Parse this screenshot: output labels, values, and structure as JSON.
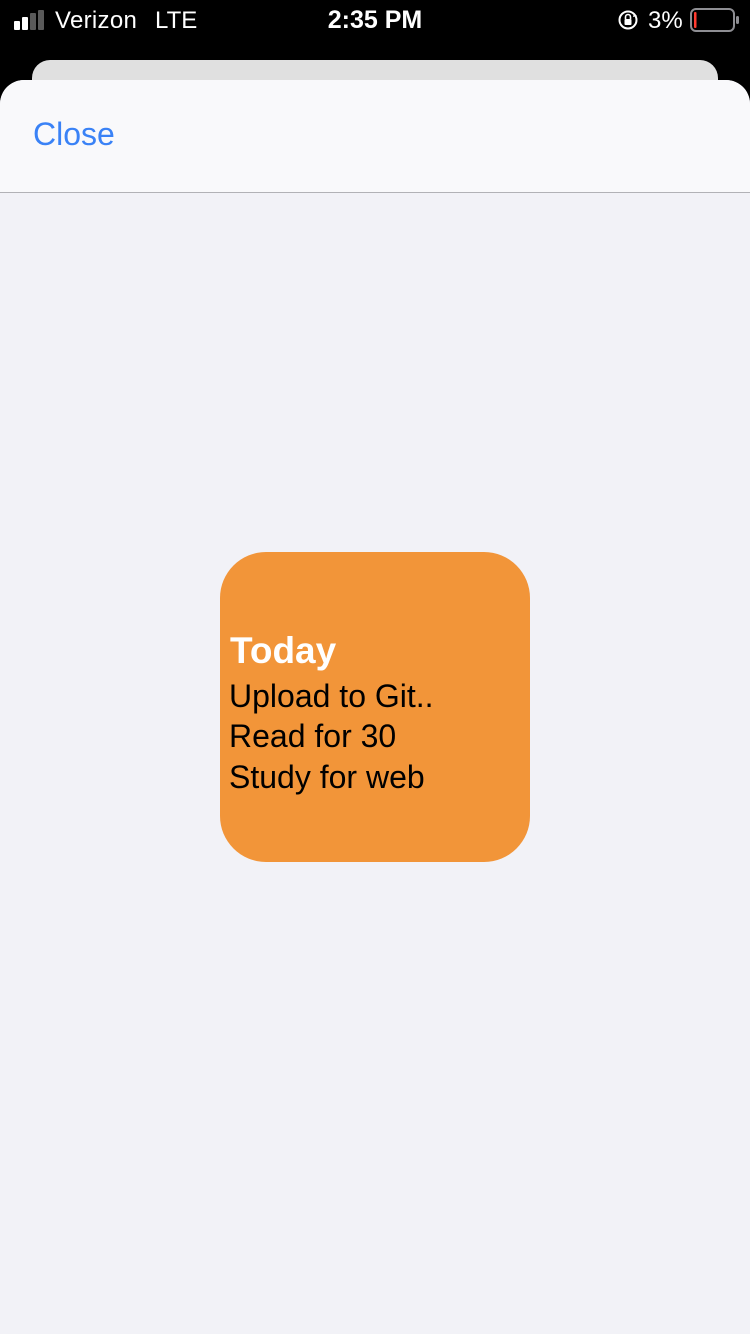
{
  "status_bar": {
    "carrier": "Verizon",
    "network": "LTE",
    "time": "2:35 PM",
    "battery_percent": "3%",
    "icons": [
      "signal-icon",
      "orientation-lock-icon",
      "battery-icon"
    ],
    "battery_color": "#ff3b30"
  },
  "nav": {
    "close_label": "Close",
    "accent_color": "#3a82f6"
  },
  "widget": {
    "title": "Today",
    "items": [
      "Upload to Git..",
      "Read for 30",
      "Study for web"
    ],
    "background_color": "#f29539"
  }
}
